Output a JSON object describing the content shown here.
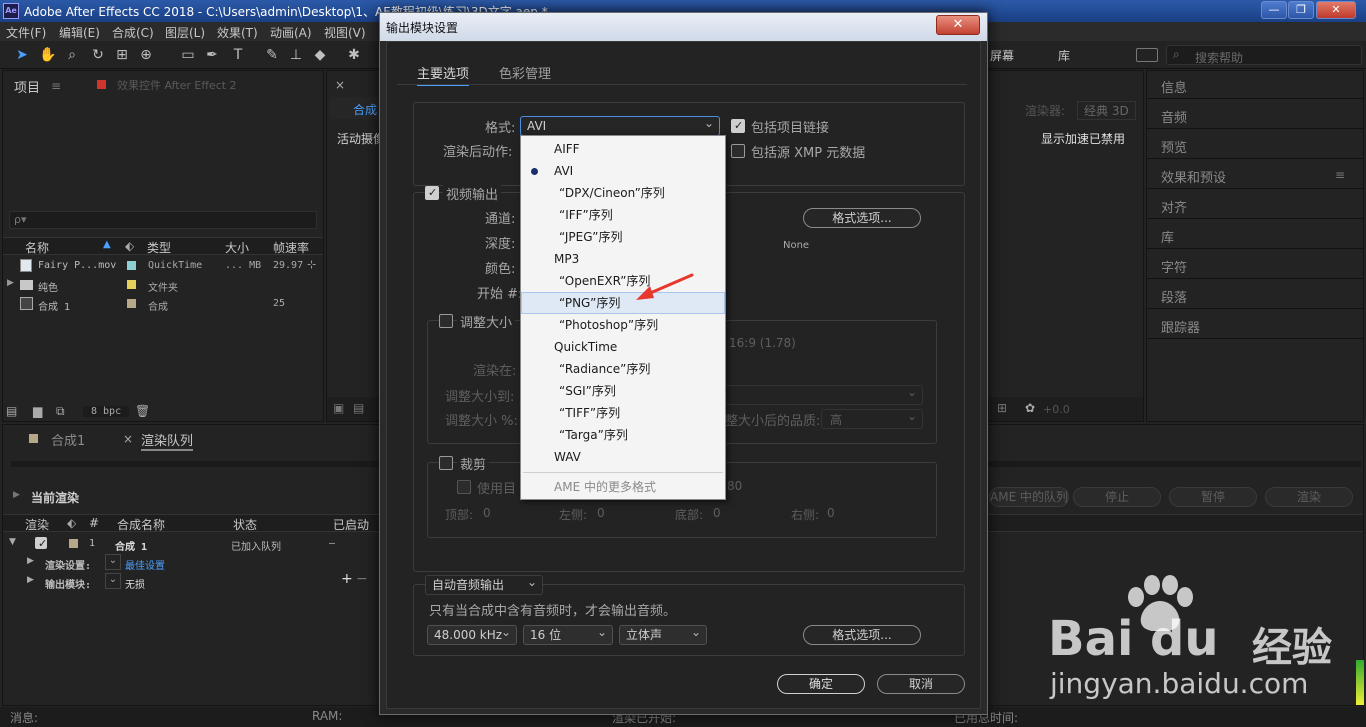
{
  "window": {
    "title": "Adobe After Effects CC 2018 - C:\\Users\\admin\\Desktop\\1、AE教程初级\\练习\\3D文字.aep *",
    "logo": "Ae",
    "minimize": "—",
    "maximize": "❐",
    "close": "✕"
  },
  "menu": [
    "文件(F)",
    "编辑(E)",
    "合成(C)",
    "图层(L)",
    "效果(T)",
    "动画(A)",
    "视图(V)"
  ],
  "toolbar_right": {
    "workspace_fragment": "屏幕",
    "library": "库",
    "search_placeholder": "搜索帮助"
  },
  "project_panel": {
    "tab_project": "项目",
    "tab_effects": "效果控件 After Effect 2",
    "search_icon": "ρ▾",
    "columns": {
      "name": "名称",
      "type": "类型",
      "size": "大小",
      "fps": "帧速率"
    },
    "rows": [
      {
        "name": "Fairy P...mov",
        "type": "QuickTime",
        "size": "... MB",
        "fps": "29.97",
        "swatch": "#8ecfd1"
      },
      {
        "name": "纯色",
        "type": "文件夹",
        "size": "",
        "fps": "",
        "swatch": "#e6d05a"
      },
      {
        "name": "合成 1",
        "type": "合成",
        "size": "",
        "fps": "25",
        "swatch": "#b8a88a"
      }
    ],
    "bpc": "8 bpc"
  },
  "comp_panel": {
    "close": "×",
    "tab": "合成",
    "camera": "活动摄像",
    "renderer_label": "渲染器:",
    "renderer_value": "经典 3D",
    "accel": "显示加速已禁用",
    "offset": "+0.0"
  },
  "right_panels": [
    "信息",
    "音频",
    "预览",
    "效果和预设",
    "对齐",
    "库",
    "字符",
    "段落",
    "跟踪器"
  ],
  "render_queue": {
    "tab_comp": "合成1",
    "tab_queue": "渲染队列",
    "current_render": "当前渲染",
    "buttons": {
      "ame": "AME 中的队列",
      "stop": "停止",
      "pause": "暂停",
      "render": "渲染"
    },
    "columns": {
      "render": "渲染",
      "num": "#",
      "comp": "合成名称",
      "status": "状态",
      "started": "已启动"
    },
    "row": {
      "num": "1",
      "comp": "合成 1",
      "status": "已加入队列",
      "started": "–"
    },
    "settings_label": "渲染设置:",
    "settings_value": "最佳设置",
    "output_label": "输出模块:",
    "output_value": "无损"
  },
  "status_bar": {
    "msg": "消息:",
    "ram": "RAM:",
    "render_start": "渲染已开始:",
    "elapsed": "已用总时间:"
  },
  "dialog": {
    "title": "输出模块设置",
    "close": "✕",
    "tabs": [
      "主要选项",
      "色彩管理"
    ],
    "format_label": "格式:",
    "format_value": "AVI",
    "post_render_label": "渲染后动作:",
    "include_link": "包括项目链接",
    "include_xmp": "包括源 XMP 元数据",
    "video_output": "视频输出",
    "channel_label": "通道:",
    "depth_label": "深度:",
    "color_label": "颜色:",
    "start_label": "开始 #:",
    "format_options": "格式选项...",
    "none": "None",
    "resize": "调整大小",
    "aspect": "16:9 (1.78)",
    "render_at": "渲染在:",
    "resize_to": "调整大小到:",
    "resize_pct": "调整大小 %:",
    "resize_quality": "整大小后的品质:",
    "quality_value": "高",
    "crop": "裁剪",
    "use_roi": "使用目",
    "crop_suffix": "80",
    "top": "顶部:",
    "left": "左侧:",
    "bottom": "底部:",
    "right": "右侧:",
    "zero": "0",
    "audio_select": "自动音频输出",
    "audio_note": "只有当合成中含有音频时，才会输出音频。",
    "sample_rate": "48.000 kHz",
    "bit_depth": "16 位",
    "channels": "立体声",
    "ok": "确定",
    "cancel": "取消"
  },
  "format_dropdown": {
    "options": [
      "AIFF",
      "AVI",
      "“DPX/Cineon”序列",
      "“IFF”序列",
      "“JPEG”序列",
      "MP3",
      "“OpenEXR”序列",
      "“PNG”序列",
      "“Photoshop”序列",
      "QuickTime",
      "“Radiance”序列",
      "“SGI”序列",
      "“TIFF”序列",
      "“Targa”序列",
      "WAV"
    ],
    "selected": "AVI",
    "highlighted": "“PNG”序列",
    "more": "AME 中的更多格式"
  },
  "watermark": {
    "brand": "Bai",
    "brand2": "du",
    "jy": "经验",
    "url": "jingyan.baidu.com"
  },
  "colors": {
    "accent": "#2d8ceb",
    "arrow": "#e8372c",
    "panel_bg": "#232323"
  }
}
